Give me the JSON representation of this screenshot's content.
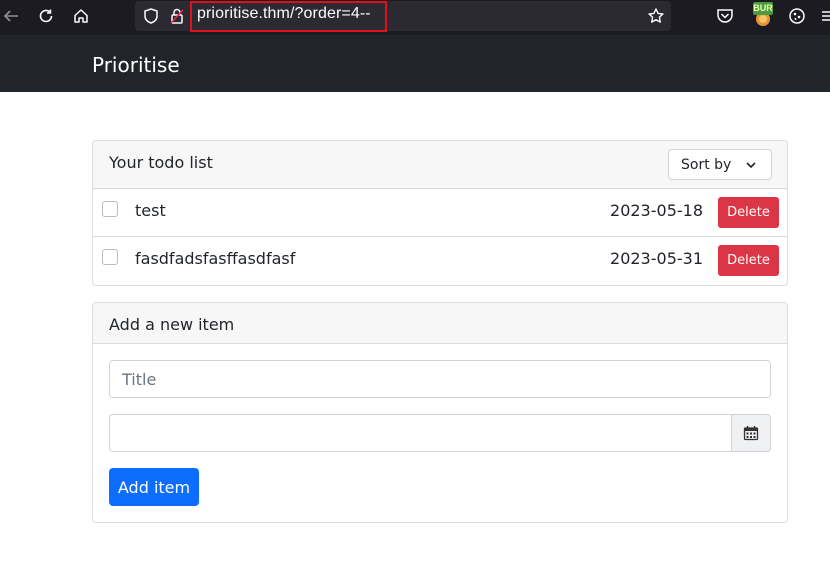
{
  "browser": {
    "url": "prioritise.thm/?order=4--",
    "extension_badge": "BUR"
  },
  "navbar": {
    "brand": "Prioritise"
  },
  "todo_card": {
    "title": "Your todo list",
    "sort_label": "Sort by",
    "items": [
      {
        "title": "test",
        "date": "2023-05-18",
        "delete_label": "Delete",
        "checked": false
      },
      {
        "title": "fasdfadsfasffasdfasf",
        "date": "2023-05-31",
        "delete_label": "Delete",
        "checked": false
      }
    ]
  },
  "add_card": {
    "title": "Add a new item",
    "title_placeholder": "Title",
    "date_value": "",
    "add_label": "Add item"
  },
  "colors": {
    "navbar_bg": "#212529",
    "delete": "#dc3545",
    "primary": "#0d6efd",
    "url_highlight": "#e0111b"
  },
  "icons": {
    "back": "arrow-left-icon",
    "reload": "reload-icon",
    "home": "home-icon",
    "shield": "shield-icon",
    "lock": "lock-icon",
    "bookmark": "star-icon",
    "pocket": "pocket-icon",
    "burp": "burp-extension-icon",
    "cookie": "cookie-icon",
    "calendar": "calendar-icon",
    "chevron": "chevron-down-icon"
  }
}
